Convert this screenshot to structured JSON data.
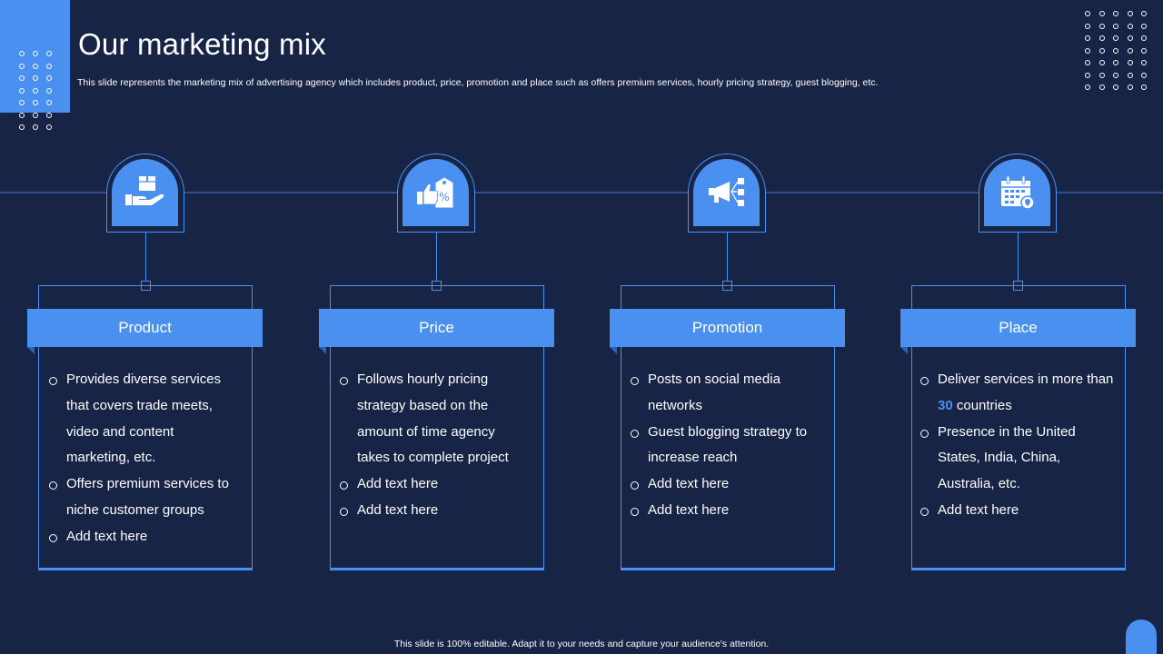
{
  "title": "Our marketing mix",
  "subtitle": "This slide represents the marketing mix of advertising agency which includes product, price, promotion and place such as offers premium services, hourly pricing strategy, guest blogging, etc.",
  "footer": "This slide is 100% editable. Adapt it to your needs and capture your audience's attention.",
  "colors": {
    "background": "#172446",
    "accent": "#4a90f0",
    "text": "#ffffff"
  },
  "cards": [
    {
      "icon": "hand-box-icon",
      "label": "Product",
      "items": [
        "Provides diverse services that covers trade meets, video and content marketing, etc.",
        "Offers premium services to niche customer groups",
        "Add text here"
      ]
    },
    {
      "icon": "hand-price-tag-icon",
      "label": "Price",
      "items": [
        "Follows hourly pricing strategy based on the amount of time agency takes to complete project",
        "Add text here",
        "Add text here"
      ]
    },
    {
      "icon": "megaphone-icon",
      "label": "Promotion",
      "items": [
        "Posts on social media networks",
        "Guest blogging strategy to increase reach",
        "Add text here",
        "Add text here"
      ]
    },
    {
      "icon": "calendar-location-icon",
      "label": "Place",
      "items_rich": {
        "item0_pre": "Deliver services in more than ",
        "item0_num": "30",
        "item0_post": " countries"
      },
      "items": [
        "Presence in the United States, India, China, Australia, etc.",
        "Add text here"
      ]
    }
  ]
}
